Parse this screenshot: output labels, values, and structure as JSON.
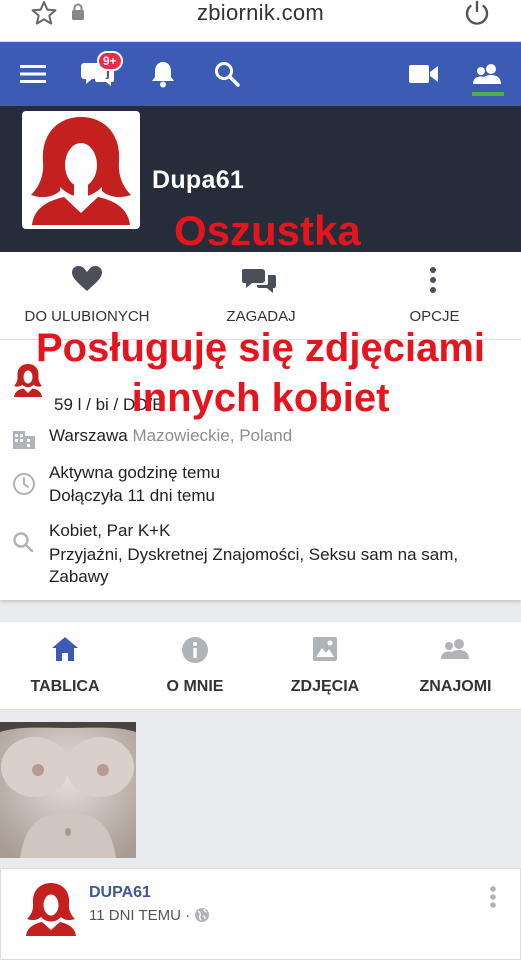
{
  "browser": {
    "url": "zbiornik.com",
    "icons": [
      "star-icon",
      "lock-icon",
      "reload-icon"
    ]
  },
  "topnav": {
    "message_badge": "9+",
    "icons": [
      "menu-icon",
      "messages-icon",
      "bell-icon",
      "search-icon",
      "video-icon",
      "friends-icon"
    ],
    "accent_color": "#3b5bb5",
    "active_underline_color": "#4caf50"
  },
  "profile": {
    "username": "Dupa61",
    "overlay_label": "Oszustka"
  },
  "actions": [
    {
      "label": "DO ULUBIONYCH",
      "icon": "heart-icon"
    },
    {
      "label": "ZAGADAJ",
      "icon": "chat-icon"
    },
    {
      "label": "OPCJE",
      "icon": "more-vertical-icon"
    }
  ],
  "overlay_banner": {
    "line1": "Posługuję się zdjęciami",
    "line2": "innych kobiet",
    "color": "#e6141d"
  },
  "info": {
    "stats": "59 l / bi / DD/E",
    "city": "Warszawa",
    "region": "Mazowieckie, Poland",
    "activity": "Aktywna godzinę temu",
    "joined": "Dołączyła 11 dni temu",
    "looking_for": "Kobiet, Par K+K",
    "interests": "Przyjaźni, Dyskretnej Znajomości, Seksu sam na sam, Zabawy"
  },
  "tabs": [
    {
      "label": "TABLICA",
      "icon": "home-icon"
    },
    {
      "label": "O MNIE",
      "icon": "info-icon"
    },
    {
      "label": "ZDJĘCIA",
      "icon": "image-icon"
    },
    {
      "label": "ZNAJOMI",
      "icon": "friends-icon"
    }
  ],
  "post": {
    "author": "DUPA61",
    "time": "11 DNI TEMU",
    "separator": "·"
  }
}
